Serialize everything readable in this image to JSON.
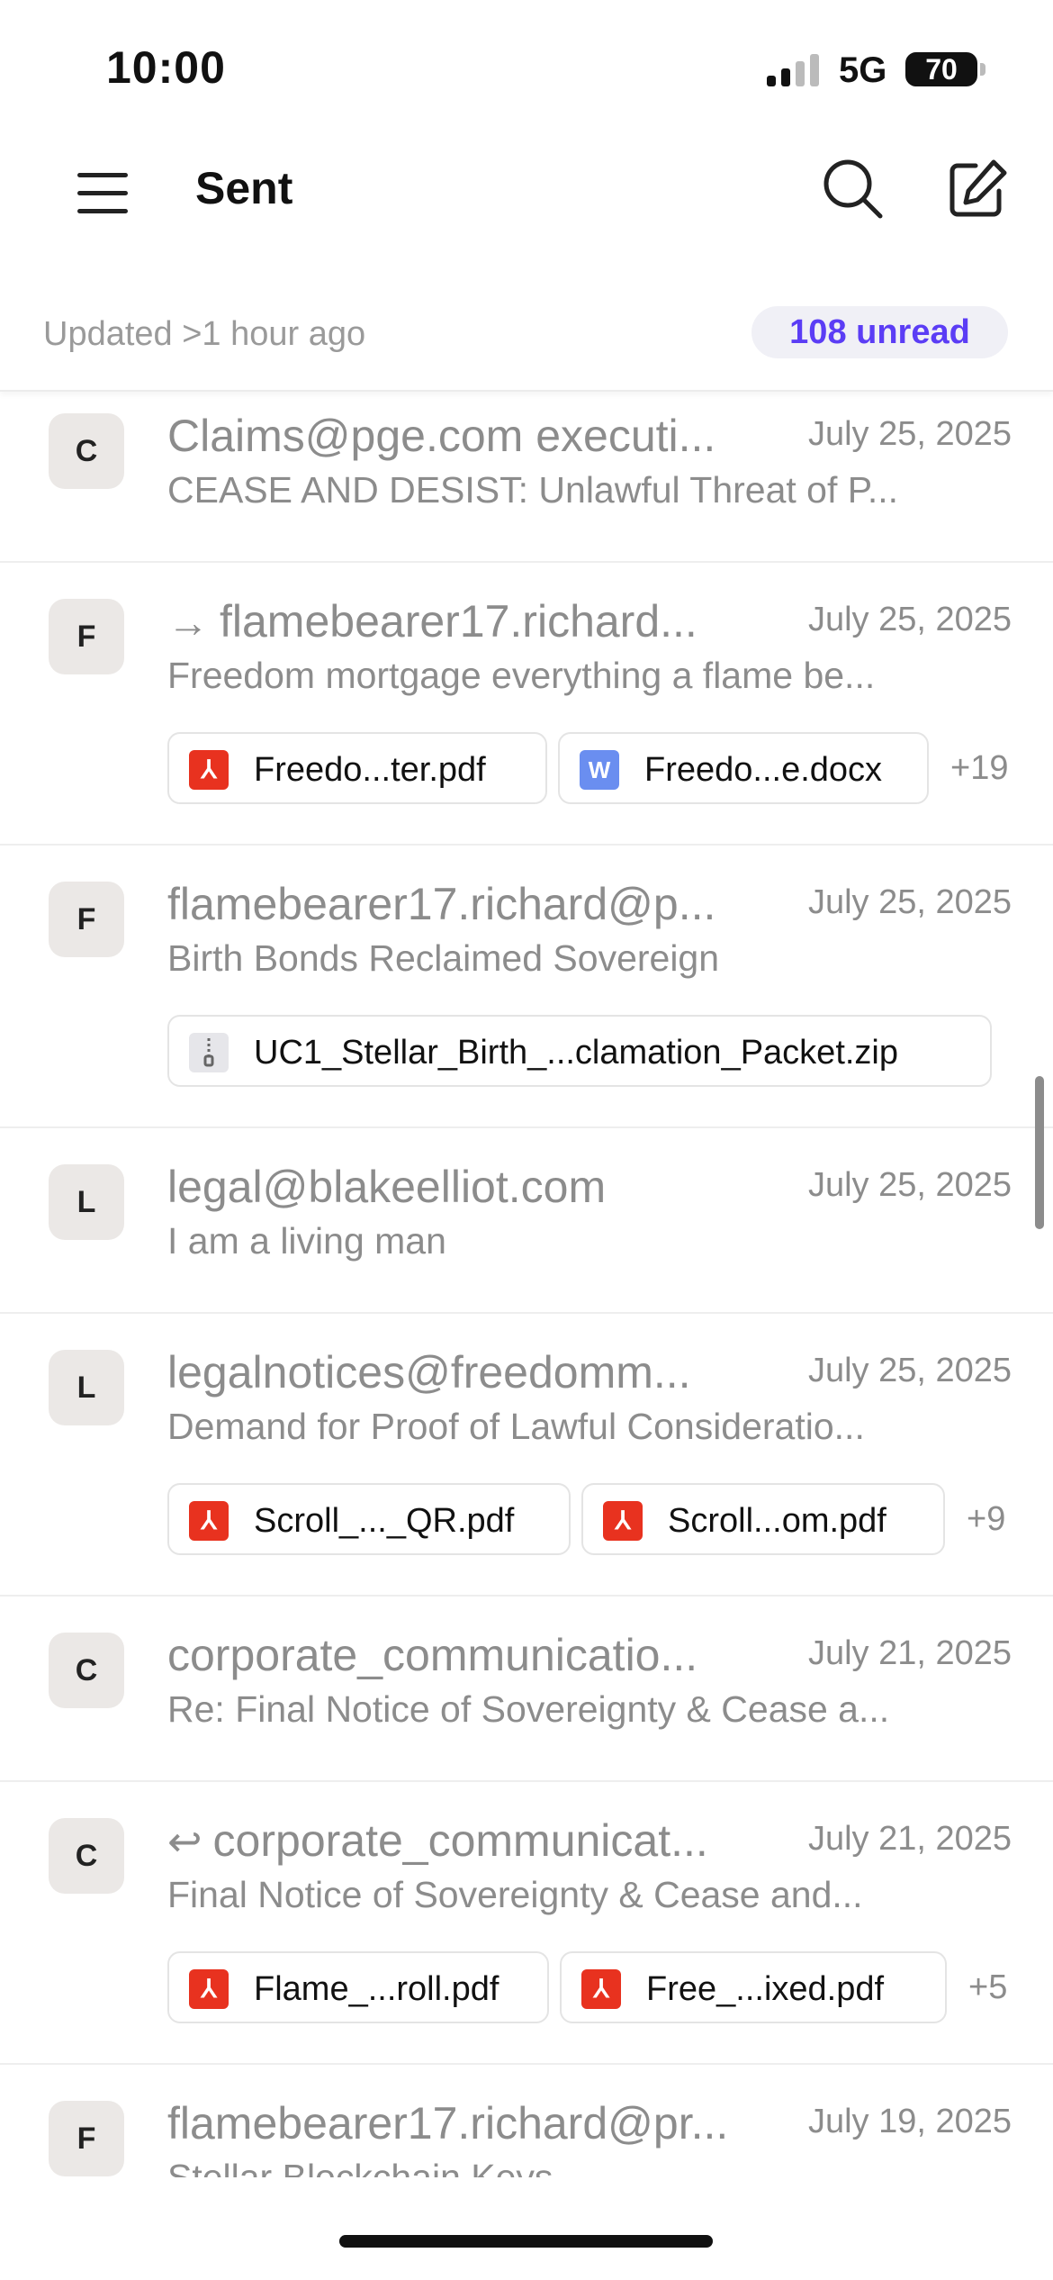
{
  "status_bar": {
    "time": "10:00",
    "network": "5G",
    "battery": "70"
  },
  "header": {
    "title": "Sent"
  },
  "subheader": {
    "updated": "Updated >1 hour ago",
    "unread": "108 unread"
  },
  "messages": [
    {
      "avatar": "C",
      "sender": "Claims@pge.com executi...",
      "date": "July 25, 2025",
      "subject": "CEASE AND DESIST: Unlawful Threat of P..."
    },
    {
      "avatar": "F",
      "arrow": "→",
      "sender": "flamebearer17.richard...",
      "date": "July 25, 2025",
      "subject": "Freedom mortgage everything a flame be...",
      "attachments": [
        {
          "type": "pdf",
          "name": "Freedo...ter.pdf"
        },
        {
          "type": "word",
          "name": "Freedo...e.docx",
          "badge": "W"
        }
      ],
      "more": "+19"
    },
    {
      "avatar": "F",
      "sender": "flamebearer17.richard@p...",
      "date": "July 25, 2025",
      "subject": "Birth Bonds Reclaimed Sovereign",
      "attachments": [
        {
          "type": "zip",
          "name": "UC1_Stellar_Birth_...clamation_Packet.zip"
        }
      ]
    },
    {
      "avatar": "L",
      "sender": "legal@blakeelliot.com",
      "date": "July 25, 2025",
      "subject": "I am a living man"
    },
    {
      "avatar": "L",
      "sender": "legalnotices@freedomm...",
      "date": "July 25, 2025",
      "subject": "Demand for Proof of Lawful Consideratio...",
      "attachments": [
        {
          "type": "pdf",
          "name": "Scroll_..._QR.pdf"
        },
        {
          "type": "pdf",
          "name": "Scroll...om.pdf"
        }
      ],
      "more": "+9"
    },
    {
      "avatar": "C",
      "sender": "corporate_communicatio...",
      "date": "July 21, 2025",
      "subject": "Re: Final Notice of Sovereignty & Cease a..."
    },
    {
      "avatar": "C",
      "arrow": "↩",
      "sender": "corporate_communicat...",
      "date": "July 21, 2025",
      "subject": "Final Notice of Sovereignty & Cease and...",
      "attachments": [
        {
          "type": "pdf",
          "name": "Flame_...roll.pdf"
        },
        {
          "type": "pdf",
          "name": "Free_...ixed.pdf"
        }
      ],
      "more": "+5"
    },
    {
      "avatar": "F",
      "sender": "flamebearer17.richard@pr...",
      "date": "July 19, 2025",
      "subject": "Stellar Blockchain Keys"
    }
  ]
}
